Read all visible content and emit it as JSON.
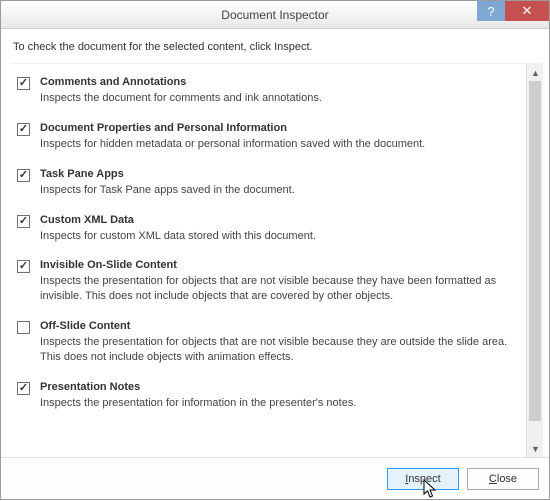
{
  "window": {
    "title": "Document Inspector"
  },
  "instruction": "To check the document for the selected content, click Inspect.",
  "items": [
    {
      "checked": true,
      "title": "Comments and Annotations",
      "desc": "Inspects the document for comments and ink annotations."
    },
    {
      "checked": true,
      "title": "Document Properties and Personal Information",
      "desc": "Inspects for hidden metadata or personal information saved with the document."
    },
    {
      "checked": true,
      "title": "Task Pane Apps",
      "desc": "Inspects for Task Pane apps saved in the document."
    },
    {
      "checked": true,
      "title": "Custom XML Data",
      "desc": "Inspects for custom XML data stored with this document."
    },
    {
      "checked": true,
      "title": "Invisible On-Slide Content",
      "desc": "Inspects the presentation for objects that are not visible because they have been formatted as invisible. This does not include objects that are covered by other objects."
    },
    {
      "checked": false,
      "title": "Off-Slide Content",
      "desc": "Inspects the presentation for objects that are not visible because they are outside the slide area.  This does not include objects with animation effects."
    },
    {
      "checked": true,
      "title": "Presentation Notes",
      "desc": "Inspects the presentation for information in the presenter's notes."
    }
  ],
  "buttons": {
    "inspect_prefix": "",
    "inspect_underline": "I",
    "inspect_suffix": "nspect",
    "close_prefix": "",
    "close_underline": "C",
    "close_suffix": "lose"
  }
}
